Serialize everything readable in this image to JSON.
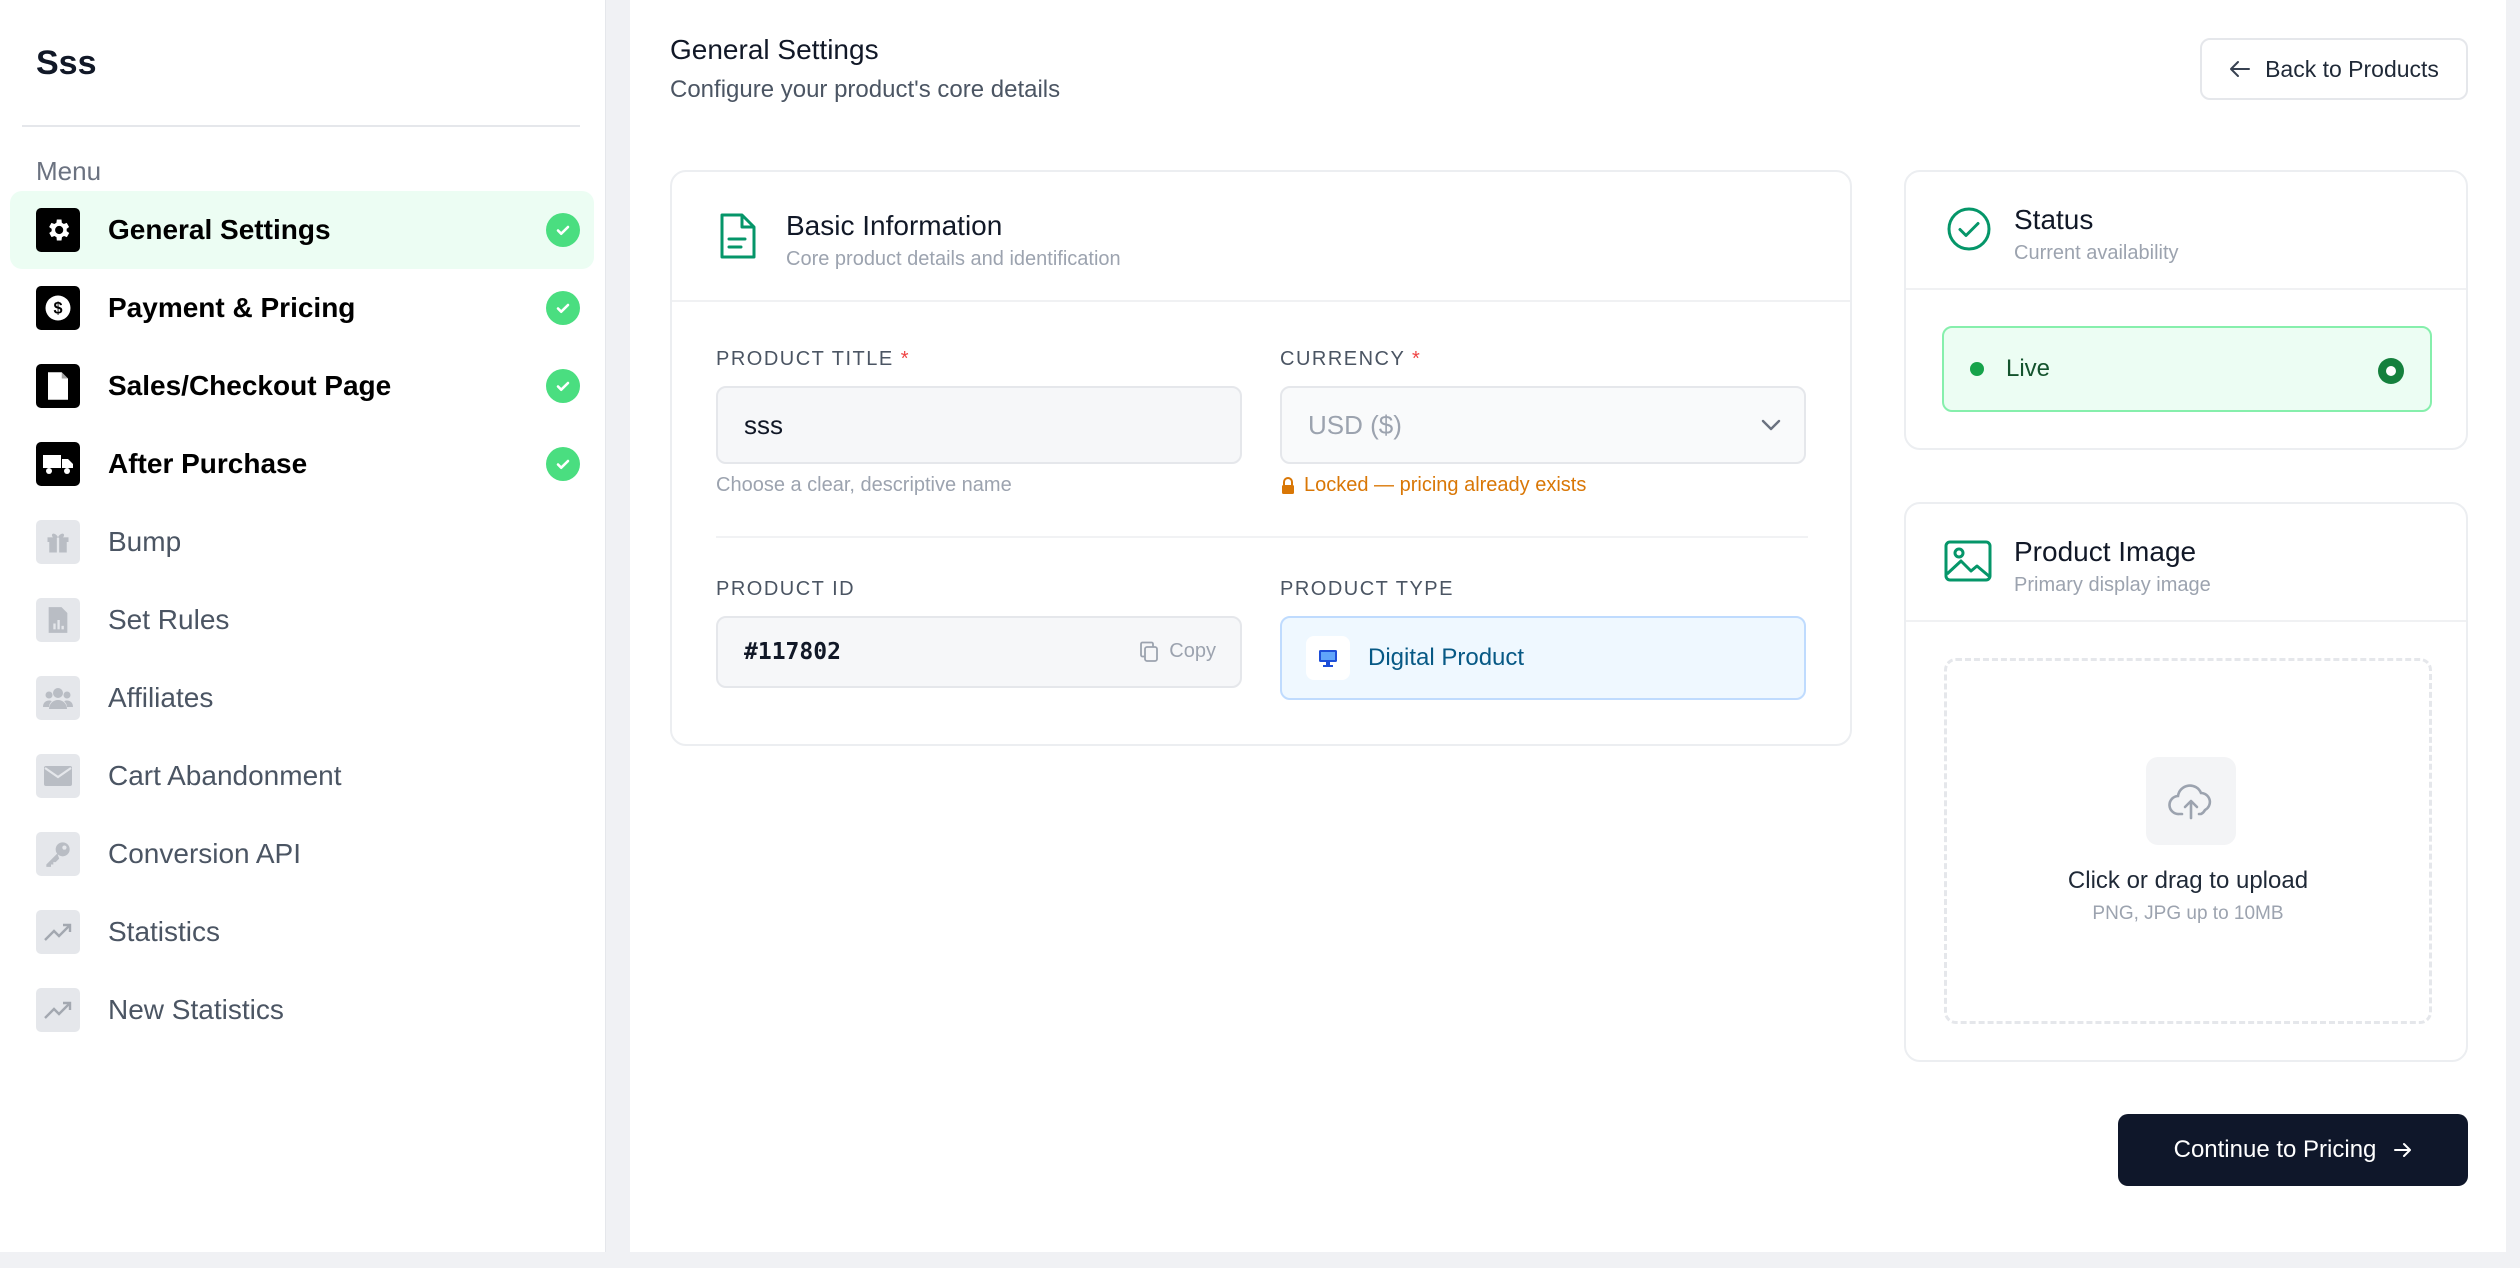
{
  "sidebar": {
    "brand": "Sss",
    "menu_label": "Menu",
    "items": [
      {
        "label": "General Settings",
        "icon": "gear-icon",
        "state": "done",
        "active": true
      },
      {
        "label": "Payment & Pricing",
        "icon": "dollar-icon",
        "state": "done"
      },
      {
        "label": "Sales/Checkout Page",
        "icon": "file-icon",
        "state": "done"
      },
      {
        "label": "After Purchase",
        "icon": "truck-icon",
        "state": "done"
      },
      {
        "label": "Bump",
        "icon": "gift-icon",
        "state": "todo"
      },
      {
        "label": "Set Rules",
        "icon": "file-chart-icon",
        "state": "todo"
      },
      {
        "label": "Affiliates",
        "icon": "users-icon",
        "state": "todo"
      },
      {
        "label": "Cart Abandonment",
        "icon": "envelope-icon",
        "state": "todo"
      },
      {
        "label": "Conversion API",
        "icon": "key-icon",
        "state": "todo"
      },
      {
        "label": "Statistics",
        "icon": "trending-up-icon",
        "state": "todo"
      },
      {
        "label": "New Statistics",
        "icon": "trending-up-icon",
        "state": "todo"
      }
    ]
  },
  "header": {
    "title": "General Settings",
    "subtitle": "Configure your product's core details",
    "back_label": "Back to Products"
  },
  "basic": {
    "title": "Basic Information",
    "subtitle": "Core product details and identification",
    "product_title_label": "PRODUCT TITLE",
    "product_title_value": "sss",
    "product_title_hint": "Choose a clear, descriptive name",
    "currency_label": "CURRENCY",
    "currency_value": "USD ($)",
    "currency_warning": "Locked — pricing already exists",
    "product_id_label": "PRODUCT ID",
    "product_id_value": "#117802",
    "copy_label": "Copy",
    "product_type_label": "PRODUCT TYPE",
    "product_type_value": "Digital Product",
    "required_mark": "*"
  },
  "status": {
    "title": "Status",
    "subtitle": "Current availability",
    "value": "Live"
  },
  "image": {
    "title": "Product Image",
    "subtitle": "Primary display image",
    "upload_text": "Click or drag to upload",
    "upload_hint": "PNG, JPG up to 10MB"
  },
  "cta_label": "Continue to Pricing",
  "colors": {
    "accent_green": "#4ade80",
    "brand_teal": "#059669",
    "warning": "#d97706",
    "dark": "#0f172a"
  }
}
